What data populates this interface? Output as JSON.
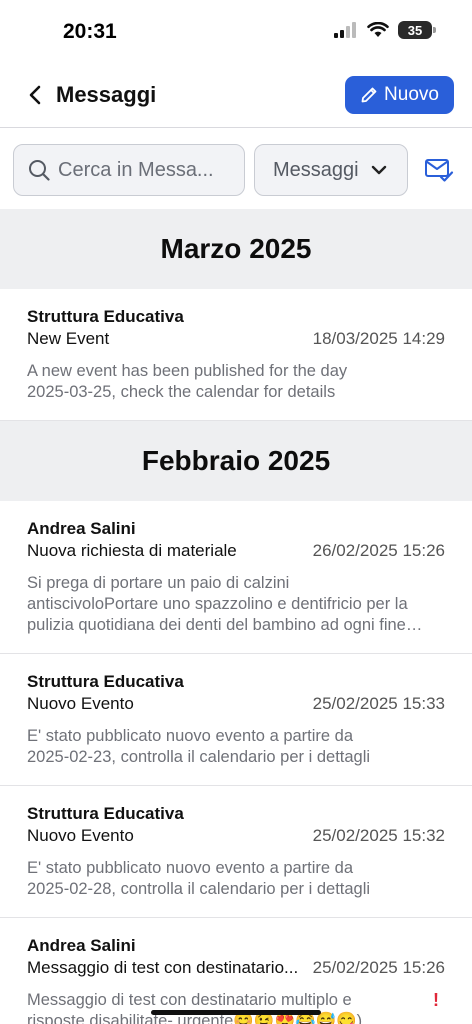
{
  "status": {
    "time": "20:31",
    "battery": "35"
  },
  "header": {
    "title": "Messaggi",
    "new_label": "Nuovo"
  },
  "search": {
    "placeholder": "Cerca in  Messa..."
  },
  "filter": {
    "selected": "Messaggi"
  },
  "sections": [
    {
      "title": "Marzo 2025"
    },
    {
      "title": "Febbraio 2025"
    }
  ],
  "messages": [
    {
      "sender": "Struttura Educativa",
      "subject": "New Event",
      "date": "18/03/2025 14:29",
      "preview_lines": [
        "A new event has been published for the day",
        "2025-03-25, check the calendar for details"
      ]
    },
    {
      "sender": "Andrea Salini",
      "subject": "Nuova richiesta di materiale",
      "date": "26/02/2025 15:26",
      "preview_lines": [
        "Si prega di portare un paio di calzini",
        "antiscivoloPortare uno spazzolino e dentifricio per la",
        "pulizia quotidiana dei denti del bambino ad ogni fine…"
      ]
    },
    {
      "sender": "Struttura Educativa",
      "subject": "Nuovo Evento",
      "date": "25/02/2025 15:33",
      "preview_lines": [
        "E' stato pubblicato nuovo evento a partire da",
        "2025-02-23, controlla il calendario per i dettagli"
      ]
    },
    {
      "sender": "Struttura Educativa",
      "subject": "Nuovo Evento",
      "date": "25/02/2025 15:32",
      "preview_lines": [
        "E' stato pubblicato nuovo evento a partire da",
        "2025-02-28, controlla il calendario per i dettagli"
      ]
    },
    {
      "sender": "Andrea Salini",
      "subject": "Messaggio di test con destinatario...",
      "date": "25/02/2025 15:26",
      "preview_lines": [
        "Messaggio di test con destinatario multiplo e",
        "risposte disabilitate- urgente😊😉😍😂😅😋)"
      ]
    }
  ],
  "alert_mark": "!"
}
